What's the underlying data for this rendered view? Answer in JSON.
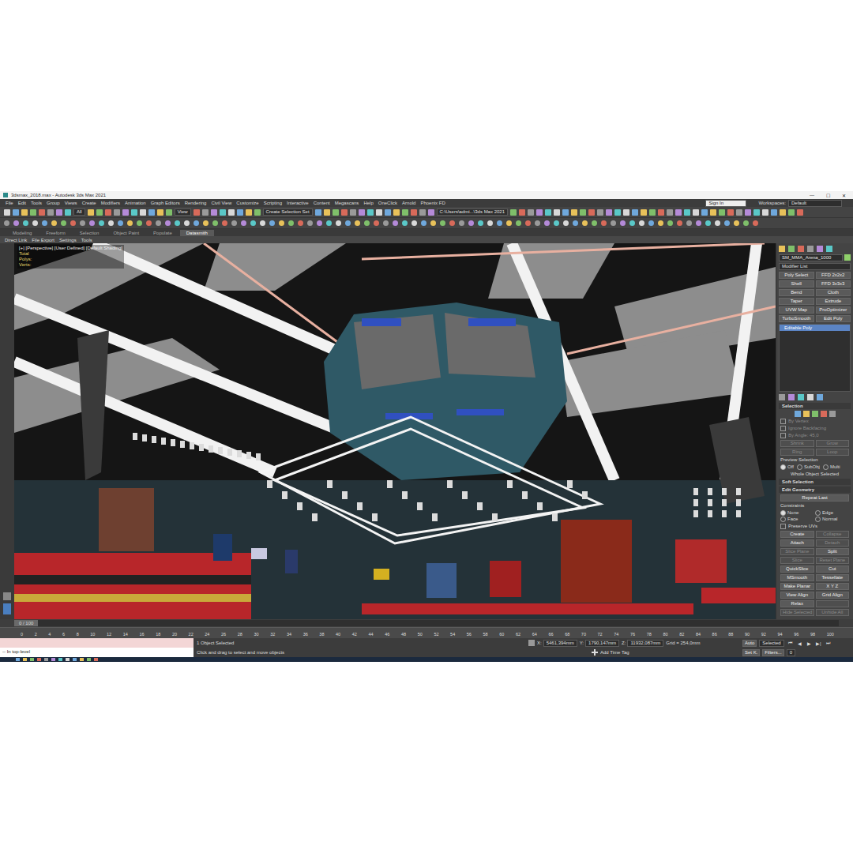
{
  "window": {
    "title": "3dsmax_2018.max - Autodesk 3ds Max 2021",
    "controls": [
      "—",
      "☐",
      "✕"
    ]
  },
  "menu": [
    "File",
    "Edit",
    "Tools",
    "Group",
    "Views",
    "Create",
    "Modifiers",
    "Animation",
    "Graph Editors",
    "Rendering",
    "Civil View",
    "Customize",
    "Scripting",
    "Interactive",
    "Content",
    "Megascans",
    "Help",
    "OneClick",
    "Arnold",
    "Phoenix FD"
  ],
  "sign_in": "Sign In",
  "workspaces": {
    "label": "Workspaces:",
    "value": "Default"
  },
  "toolbar": {
    "filter": "All",
    "view": "View",
    "selection_set": "Create Selection Set",
    "project_path": "C:\\Users\\admi...\\3ds Max 2021"
  },
  "ribbon_tabs": [
    {
      "label": "Modeling",
      "selected": false
    },
    {
      "label": "Freeform",
      "selected": false
    },
    {
      "label": "Selection",
      "selected": false
    },
    {
      "label": "Object Paint",
      "selected": false
    },
    {
      "label": "Populate",
      "selected": false
    },
    {
      "label": "Datasmith",
      "selected": true
    }
  ],
  "ribbon_items": [
    "Direct Link",
    "File Export",
    "Settings",
    "Tools"
  ],
  "viewport": {
    "label": "[+] [Perspective] [User Defined] [Default Shading]",
    "stats": [
      "Total",
      "Polys:",
      "Verts:"
    ]
  },
  "command_panel": {
    "object_name": "SM_MMA_Arena_1000",
    "modifier_list": "Modifier List",
    "modifiers": [
      "Poly Select",
      "FFD 2x2x2",
      "Shell",
      "FFD 3x3x3",
      "Bend",
      "Cloth",
      "Taper",
      "Extrude",
      "UVW Map",
      "ProOptimizer",
      "TurboSmooth",
      "Edit Poly"
    ],
    "stack": [
      {
        "label": "Editable Poly",
        "selected": true
      }
    ],
    "selection": {
      "title": "Selection",
      "options": [
        {
          "label": "By Vertex",
          "checked": false,
          "disabled": true
        },
        {
          "label": "Ignore Backfacing",
          "checked": false,
          "disabled": true
        },
        {
          "label": "By Angle: 45,0",
          "checked": false,
          "disabled": true
        }
      ],
      "buttons": [
        {
          "label": "Shrink",
          "disabled": true
        },
        {
          "label": "Grow",
          "disabled": true
        },
        {
          "label": "Ring",
          "disabled": true
        },
        {
          "label": "Loop",
          "disabled": true
        }
      ],
      "preview_label": "Preview Selection",
      "preview": [
        {
          "label": "Off",
          "selected": true
        },
        {
          "label": "SubObj",
          "selected": false
        },
        {
          "label": "Multi",
          "selected": false
        }
      ],
      "status": "Whole Object Selected"
    },
    "soft_selection": {
      "title": "Soft Selection"
    },
    "edit_geometry": {
      "title": "Edit Geometry",
      "repeat_last": "Repeat Last",
      "constraints_label": "Constraints",
      "constraints": [
        {
          "label": "None",
          "selected": true
        },
        {
          "label": "Edge",
          "selected": false
        },
        {
          "label": "Face",
          "selected": false
        },
        {
          "label": "Normal",
          "selected": false
        }
      ],
      "preserve_uvs": {
        "label": "Preserve UVs",
        "checked": false
      },
      "buttons": [
        {
          "label": "Create",
          "disabled": false
        },
        {
          "label": "Collapse",
          "disabled": true
        },
        {
          "label": "Attach",
          "disabled": false
        },
        {
          "label": "Detach",
          "disabled": true
        },
        {
          "label": "Slice Plane",
          "disabled": true
        },
        {
          "label": "Split",
          "disabled": false
        },
        {
          "label": "Slice",
          "disabled": true
        },
        {
          "label": "Reset Plane",
          "disabled": true
        },
        {
          "label": "QuickSlice",
          "disabled": false
        },
        {
          "label": "Cut",
          "disabled": false
        },
        {
          "label": "MSmooth",
          "disabled": false
        },
        {
          "label": "Tessellate",
          "disabled": false
        },
        {
          "label": "Make Planar",
          "disabled": false
        },
        {
          "label": "X Y Z",
          "disabled": false
        },
        {
          "label": "View Align",
          "disabled": false
        },
        {
          "label": "Grid Align",
          "disabled": false
        },
        {
          "label": "Relax",
          "disabled": false
        },
        {
          "label": "",
          "disabled": true
        },
        {
          "label": "Hide Selected",
          "disabled": true
        },
        {
          "label": "Unhide All",
          "disabled": true
        }
      ]
    }
  },
  "timeline": {
    "frame_label": "0 / 100",
    "level": 0,
    "ticks": [
      "0",
      "2",
      "4",
      "6",
      "8",
      "10",
      "12",
      "14",
      "16",
      "18",
      "20",
      "22",
      "24",
      "26",
      "28",
      "30",
      "32",
      "34",
      "36",
      "38",
      "40",
      "42",
      "44",
      "46",
      "48",
      "50",
      "52",
      "54",
      "56",
      "58",
      "60",
      "62",
      "64",
      "66",
      "68",
      "70",
      "72",
      "74",
      "76",
      "78",
      "80",
      "82",
      "84",
      "86",
      "88",
      "90",
      "92",
      "94",
      "96",
      "98",
      "100"
    ]
  },
  "status_bar": {
    "script_output": "-- In top-level",
    "selection_info": "1 Object Selected",
    "prompt": "Click and drag to select and move objects",
    "coords": [
      {
        "label": "X:",
        "value": "5461,394mm"
      },
      {
        "label": "Y:",
        "value": "1790,147mm"
      },
      {
        "label": "Z:",
        "value": "11932,087mm"
      }
    ],
    "grid": "Grid = 254,0mm",
    "add_time_tag": "Add Time Tag",
    "auto_key": "Auto",
    "key_filter": "Selected",
    "set_key": "Set K.",
    "filters": "Filters...",
    "frame": "0",
    "playback": [
      "⏮",
      "◀",
      "▶",
      "▶|",
      "⏭"
    ]
  }
}
